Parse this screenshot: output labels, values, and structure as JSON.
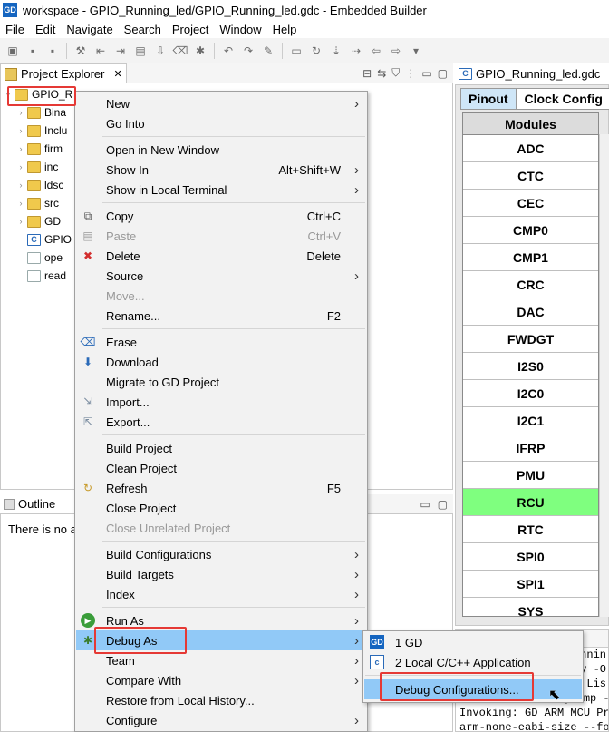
{
  "window": {
    "title": "workspace - GPIO_Running_led/GPIO_Running_led.gdc - Embedded Builder",
    "logo": "GD"
  },
  "menubar": [
    "File",
    "Edit",
    "Navigate",
    "Search",
    "Project",
    "Window",
    "Help"
  ],
  "project_explorer": {
    "tab": "Project Explorer",
    "tree": [
      {
        "label": "GPIO_R",
        "icon": "project-icon",
        "expanded": true
      },
      {
        "label": "Bina",
        "icon": "binaries-icon"
      },
      {
        "label": "Inclu",
        "icon": "includes-icon"
      },
      {
        "label": "firm",
        "icon": "folder-icon"
      },
      {
        "label": "inc",
        "icon": "folder-icon"
      },
      {
        "label": "ldsc",
        "icon": "folder-icon"
      },
      {
        "label": "src",
        "icon": "folder-icon"
      },
      {
        "label": "GD",
        "icon": "folder-icon"
      },
      {
        "label": "GPIO",
        "icon": "c-file-icon"
      },
      {
        "label": "ope",
        "icon": "file-icon"
      },
      {
        "label": "read",
        "icon": "file-icon"
      }
    ]
  },
  "outline": {
    "tab": "Outline",
    "message": "There is no a"
  },
  "editor": {
    "tab": "GPIO_Running_led.gdc",
    "subtabs": [
      "Pinout",
      "Clock Config"
    ],
    "modules_header": "Modules",
    "modules": [
      "ADC",
      "CTC",
      "CEC",
      "CMP0",
      "CMP1",
      "CRC",
      "DAC",
      "FWDGT",
      "I2S0",
      "I2C0",
      "I2C1",
      "IFRP",
      "PMU",
      "RCU",
      "RTC",
      "SPI0",
      "SPI1",
      "SYS"
    ],
    "active_module": "RCU"
  },
  "console": {
    "lines": [
      "_Runnin",
      "y -O",
      "J Lis",
      "arm-none-eabi-objdump --",
      "Invoking: GD ARM MCU Pri",
      "arm-none-eabi-size --for"
    ]
  },
  "context_menu": {
    "items": [
      {
        "label": "New",
        "arrow": true
      },
      {
        "label": "Go Into"
      },
      {
        "sep": true
      },
      {
        "label": "Open in New Window"
      },
      {
        "label": "Show In",
        "accel": "Alt+Shift+W",
        "arrow": true
      },
      {
        "label": "Show in Local Terminal",
        "arrow": true
      },
      {
        "sep": true
      },
      {
        "label": "Copy",
        "accel": "Ctrl+C",
        "icon": "copy-icon"
      },
      {
        "label": "Paste",
        "accel": "Ctrl+V",
        "icon": "paste-icon",
        "disabled": true
      },
      {
        "label": "Delete",
        "accel": "Delete",
        "icon": "delete-icon"
      },
      {
        "label": "Source",
        "arrow": true
      },
      {
        "label": "Move...",
        "disabled": true
      },
      {
        "label": "Rename...",
        "accel": "F2"
      },
      {
        "sep": true
      },
      {
        "label": "Erase",
        "icon": "erase-icon"
      },
      {
        "label": "Download",
        "icon": "download-icon"
      },
      {
        "label": "Migrate to GD Project"
      },
      {
        "label": "Import...",
        "icon": "import-icon"
      },
      {
        "label": "Export...",
        "icon": "export-icon"
      },
      {
        "sep": true
      },
      {
        "label": "Build Project"
      },
      {
        "label": "Clean Project"
      },
      {
        "label": "Refresh",
        "accel": "F5",
        "icon": "refresh-icon"
      },
      {
        "label": "Close Project"
      },
      {
        "label": "Close Unrelated Project",
        "disabled": true
      },
      {
        "sep": true
      },
      {
        "label": "Build Configurations",
        "arrow": true
      },
      {
        "label": "Build Targets",
        "arrow": true
      },
      {
        "label": "Index",
        "arrow": true
      },
      {
        "sep": true
      },
      {
        "label": "Run As",
        "arrow": true,
        "icon": "run-icon"
      },
      {
        "label": "Debug As",
        "arrow": true,
        "icon": "debug-icon",
        "highlighted": true
      },
      {
        "label": "Team",
        "arrow": true
      },
      {
        "label": "Compare With",
        "arrow": true
      },
      {
        "label": "Restore from Local History..."
      },
      {
        "label": "Configure",
        "arrow": true
      }
    ]
  },
  "debug_submenu": {
    "items": [
      {
        "label": "1 GD",
        "icon": "gd-icon",
        "icon_text": "GD"
      },
      {
        "label": "2 Local C/C++ Application",
        "icon": "c-app-icon",
        "icon_text": "c"
      },
      {
        "sep": true
      },
      {
        "label": "Debug Configurations...",
        "highlighted": true
      }
    ]
  }
}
